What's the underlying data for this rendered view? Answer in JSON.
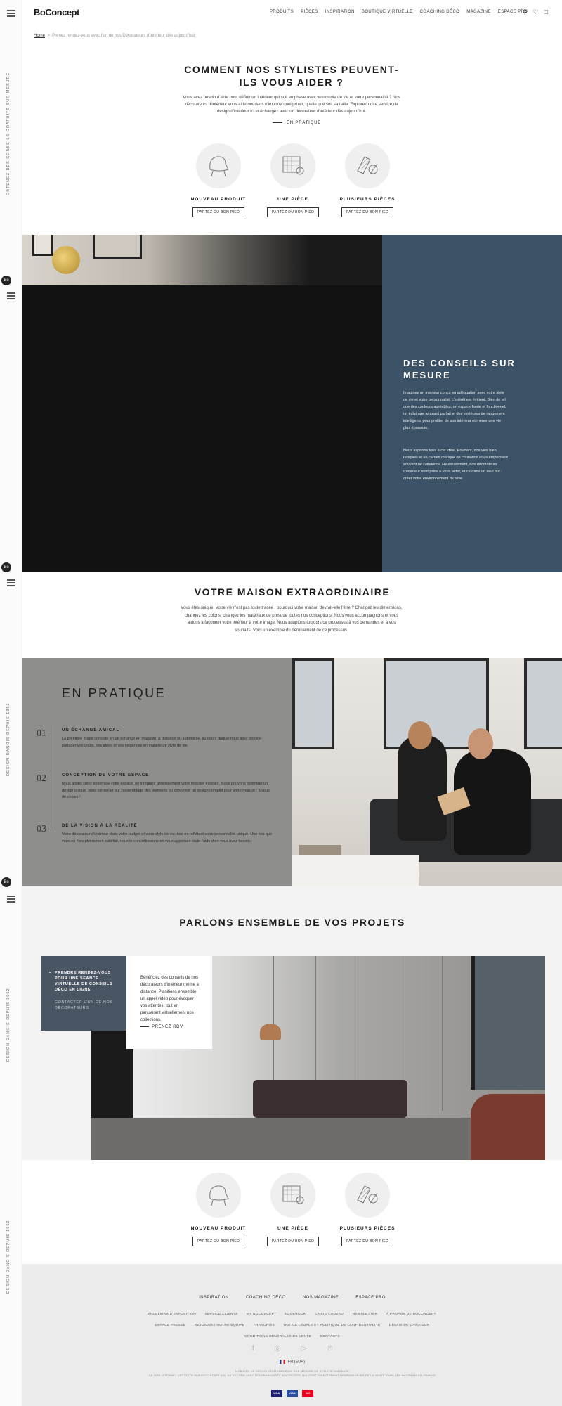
{
  "rail": {
    "texts": [
      "Obtenez des conseils gratuits sur mesure",
      "Design danois depuis 1952",
      "Design danois depuis 1952",
      "Design danois depuis 1952"
    ],
    "badge": "Bo"
  },
  "header": {
    "brand": "BoConcept",
    "nav": [
      "PRODUITS",
      "PIÈCES",
      "INSPIRATION",
      "BOUTIQUE VIRTUELLE",
      "COACHING DÉCO",
      "MAGAZINE",
      "ESPACE PRO"
    ],
    "icons": [
      "search-icon",
      "heart-icon",
      "bag-icon"
    ]
  },
  "breadcrumb": {
    "home": "Home",
    "sep": ">",
    "current": "Prenez rendez-vous avec l'un de nos Décorateurs d'intérieur dès aujourd'hui"
  },
  "intro": {
    "title": "COMMENT NOS STYLISTES PEUVENT-ILS VOUS AIDER ?",
    "text": "Vous avez besoin d'aide pour définir un intérieur qui soit en phase avec votre style de vie et votre personnalité ? Nos décorateurs d'intérieur vous aideront dans n'importe quel projet, quelle que soit sa taille. Explorez notre service de design d'intérieur ici et échangez avec un décorateur d'intérieur dès aujourd'hui.",
    "link": "EN PRATIQUE"
  },
  "options": [
    {
      "label": "NOUVEAU PRODUIT",
      "button": "PARTEZ DU BON PIED",
      "icon": "armchair-icon"
    },
    {
      "label": "UNE PIÈCE",
      "button": "PARTEZ DU BON PIED",
      "icon": "room-plan-icon"
    },
    {
      "label": "PLUSIEURS PIÈCES",
      "button": "PARTEZ DU BON PIED",
      "icon": "swatches-icon"
    }
  ],
  "conseils": {
    "title": "DES CONSEILS SUR MESURE",
    "p1": "Imaginez un intérieur conçu en adéquation avec votre style de vie et votre personnalité. L'intérêt est évident. Bien de tel que des couleurs agréables, un espace fluide et fonctionnel, un éclairage ambiant parfait et des systèmes de rangement intelligents pour profiter de son intérieur et mener une vie plus épanouie.",
    "p2": "Nous aspirons tous à cet idéal. Pourtant, nos vies bien remplies et un certain manque de confiance nous empêchent souvent de l'atteindre. Heureusement, nos décorateurs d'intérieur sont prêts à vous aider, et ce dans un seul but : créer votre environnement de rêve."
  },
  "maison": {
    "title": "VOTRE MAISON EXTRAORDINAIRE",
    "text": "Vous êtes unique. Votre vie n'est pas toute tracée : pourquoi votre maison devrait-elle l'être ? Changez les dimensions, changez les coloris, changez les matériaux de presque toutes nos conceptions. Nous vous accompagnons et vous aidons à façonner votre intérieur à votre image. Nous adaptons toujours ce processus à vos demandes et à vos souhaits. Voici un exemple du déroulement de ce processus."
  },
  "pratique": {
    "title": "EN PRATIQUE",
    "steps": [
      {
        "num": "01",
        "heading": "UN ÉCHANGE AMICAL",
        "text": "La première étape consiste en un échange en magasin, à distance ou à domicile, au cours duquel nous allez pouvoir partager vos goûts, vos idées et vos exigences en matière de style de vie."
      },
      {
        "num": "02",
        "heading": "CONCEPTION DE VOTRE ESPACE",
        "text": "Nous allons créer ensemble votre espace, en intégrant généralement votre mobilier existant. Nous pouvons optimiser un design unique, vous conseiller sur l'assemblage des éléments ou concevoir un design complet pour votre maison : à vous de choisir !"
      },
      {
        "num": "03",
        "heading": "DE LA VISION À LA RÉALITÉ",
        "text": "Votre décorateur d'intérieur dans votre budget et votre style de vie, tout en reflétant votre personnalité unique. Une fois que vous en êtes pleinement satisfait, nous le concrétiserons en vous apportant toute l'aide dont vous avez besoin."
      }
    ]
  },
  "projets": {
    "title": "PARLONS ENSEMBLE DE VOS PROJETS",
    "option_active": "PRENDRE RENDEZ-VOUS POUR UNE SÉANCE VIRTUELLE DE CONSEILS DÉCO EN LIGNE",
    "option_inactive": "CONTACTER L'UN DE NOS DÉCORATEURS",
    "card_text": "Bénéficiez des conseils de nos décorateurs d'intérieur même à distance! Planifions ensemble un appel vidéo pour évoquer vos attentes, tout en parcourant virtuellement nos collections.",
    "card_link": "PRENEZ RDV"
  },
  "footer": {
    "nav": [
      "INSPIRATION",
      "COACHING DÉCO",
      "NOS MAGAZINE",
      "ESPACE PRO"
    ],
    "links": [
      "MOBILIERS D'EXPOSITION",
      "SERVICE CLIENTS",
      "MY BOCONCEPT",
      "LOOKBOOK",
      "CARTE CADEAU",
      "NEWSLETTER",
      "À PROPOS DE BOCONCEPT",
      "ESPACE PRESSE",
      "REJOIGNEZ NOTRE ÉQUIPE",
      "FRANCHISE",
      "NOTICE LÉGALE ET POLITIQUE DE CONFIDENTIALITÉ",
      "DÉLAIS DE LIVRAISON",
      "CONDITIONS GÉNÉRALES DE VENTE",
      "CONTACTS"
    ],
    "social": [
      "facebook-icon",
      "instagram-icon",
      "youtube-icon",
      "pinterest-icon"
    ],
    "social_glyphs": [
      "f",
      "◎",
      "▷",
      "℗"
    ],
    "country": "FR (EUR)",
    "legal1": "MOBILIER DE DESIGN CONTEMPORAIN SUR MESURE DE STYLE SCANDINAVE",
    "legal2": "CE SITE INTERNET EST ÉDITÉ PAR BOCONCEPT A/S, EN ACCORD AVEC LES FRANCHISÉS BOCONCEPT, QUI SONT DIRECTEMENT RESPONSABLES DE LA VENTE DANS LES MAGASINS EN FRANCE",
    "cards": [
      {
        "name": "visa-icon",
        "label": "VISA",
        "color": "#1a1f71"
      },
      {
        "name": "visa-electron-icon",
        "label": "VISA",
        "color": "#2b4ea2"
      },
      {
        "name": "mastercard-icon",
        "label": "MC",
        "color": "#eb001b"
      }
    ]
  }
}
